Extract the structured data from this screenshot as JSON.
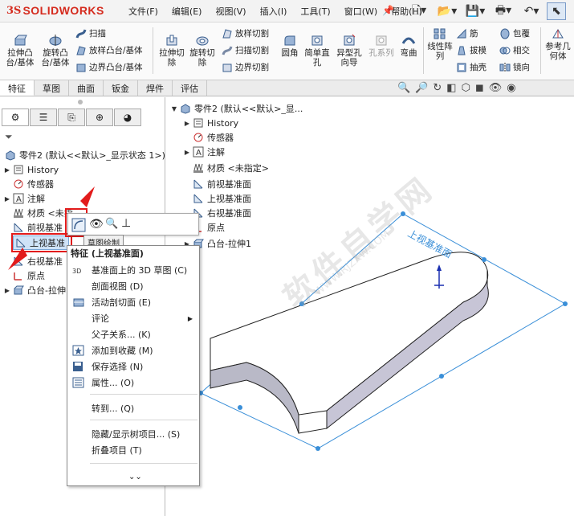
{
  "app": {
    "brand": "SOLIDWORKS",
    "brand_color": "#d52b1e"
  },
  "menu": [
    "文件(F)",
    "编辑(E)",
    "视图(V)",
    "插入(I)",
    "工具(T)",
    "窗口(W)",
    "帮助(H)"
  ],
  "ribbon": {
    "extrude_boss": "拉伸凸\n台/基体",
    "revolve_boss": "旋转凸\n台/基体",
    "sweep": "扫描",
    "loft_boss": "放样凸台/基体",
    "boundary_boss": "边界凸台/基体",
    "extrude_cut": "拉伸切\n除",
    "revolve_cut": "旋转切\n除",
    "loft_cut": "放样切割",
    "sweep_cut": "扫描切割",
    "boundary_cut": "边界切割",
    "fillet": "圆角",
    "simple_hole": "简单直\n孔",
    "hole_wizard": "异型孔\n向导",
    "hole_series": "孔系列",
    "flex": "弯曲",
    "linear_pattern": "线性阵\n列",
    "rib": "筋",
    "draft": "拔模",
    "shell": "抽壳",
    "wrap": "包覆",
    "intersect": "相交",
    "mirror": "镜向",
    "ref_geometry": "参考几\n何体"
  },
  "tabs": [
    "特征",
    "草图",
    "曲面",
    "钣金",
    "焊件",
    "评估"
  ],
  "left_tree": {
    "root": "零件2 (默认<<默认>_显示状态 1>)",
    "items": [
      "History",
      "传感器",
      "注解",
      "材质 <未指",
      "前视基准",
      "上视基准",
      "右视基准",
      "原点",
      "凸台-拉伸"
    ]
  },
  "main_tree": {
    "root": "零件2 (默认<<默认>_显...",
    "items": [
      "History",
      "传感器",
      "注解",
      "材质 <未指定>",
      "前视基准面",
      "上视基准面",
      "右视基准面",
      "原点",
      "凸台-拉伸1"
    ]
  },
  "tooltip": "草图绘制",
  "context_menu": {
    "header": "特征 (上视基准面)",
    "items": [
      "基准面上的 3D 草图 (C)",
      "剖面视图 (D)",
      "活动剖切面 (E)",
      "评论",
      "父子关系... (K)",
      "添加到收藏 (M)",
      "保存选择 (N)",
      "属性... (O)",
      "转到... (Q)",
      "隐藏/显示树项目... (S)",
      "折叠项目 (T)"
    ]
  },
  "plane_label": "上视基准面",
  "watermark": "软件自学网",
  "watermark_url": "WWW.RJZXW.COM",
  "colors": {
    "plane": "#3a8fd8",
    "highlight": "#e21b1b",
    "part": "#b9b9c7"
  }
}
